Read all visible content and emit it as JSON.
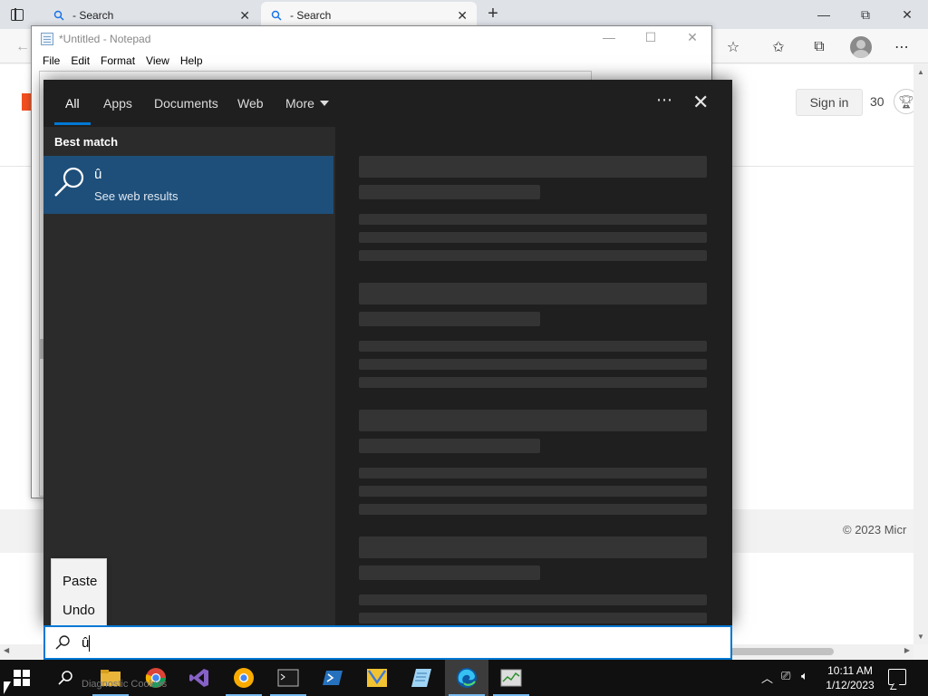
{
  "browser": {
    "tabs": [
      {
        "title": "- Search",
        "icon": "search-icon"
      },
      {
        "title": "- Search",
        "icon": "search-icon"
      }
    ],
    "window_controls": {
      "minimize": "—",
      "restore": "⧉",
      "close": "✕"
    },
    "toolbar_icons": [
      "back-icon",
      "add-favorite-icon",
      "favorites-icon",
      "collections-icon",
      "profile-avatar",
      "more-icon"
    ]
  },
  "page": {
    "sign_in_label": "Sign in",
    "points": "30",
    "footer_copyright": "© 2023 Micr"
  },
  "notepad": {
    "title": "*Untitled - Notepad",
    "menu": [
      "File",
      "Edit",
      "Format",
      "View",
      "Help"
    ]
  },
  "search_panel": {
    "tabs": [
      {
        "label": "All",
        "active": true
      },
      {
        "label": "Apps",
        "active": false
      },
      {
        "label": "Documents",
        "active": false
      },
      {
        "label": "Web",
        "active": false
      },
      {
        "label": "More",
        "active": false
      }
    ],
    "section_title": "Best match",
    "result": {
      "title": "û",
      "subtitle": "See web results"
    },
    "context_menu": [
      "Paste",
      "Undo"
    ],
    "query": "û"
  },
  "taskbar": {
    "apps": [
      "windows-start",
      "search",
      "file-explorer",
      "chrome",
      "visual-studio",
      "chrome-canary",
      "terminal",
      "powershell",
      "gmail-like",
      "notepad-like",
      "edge",
      "task-manager"
    ],
    "active_app": "edge",
    "tooltip_ghost": "Diagnostic Cookies",
    "clock_time": "10:11 AM",
    "clock_date": "1/12/2023"
  },
  "colors": {
    "accent": "#0078d4",
    "result_highlight": "#1e4f7a",
    "panel_bg": "#2b2b2b",
    "taskbar_bg": "#101010"
  }
}
